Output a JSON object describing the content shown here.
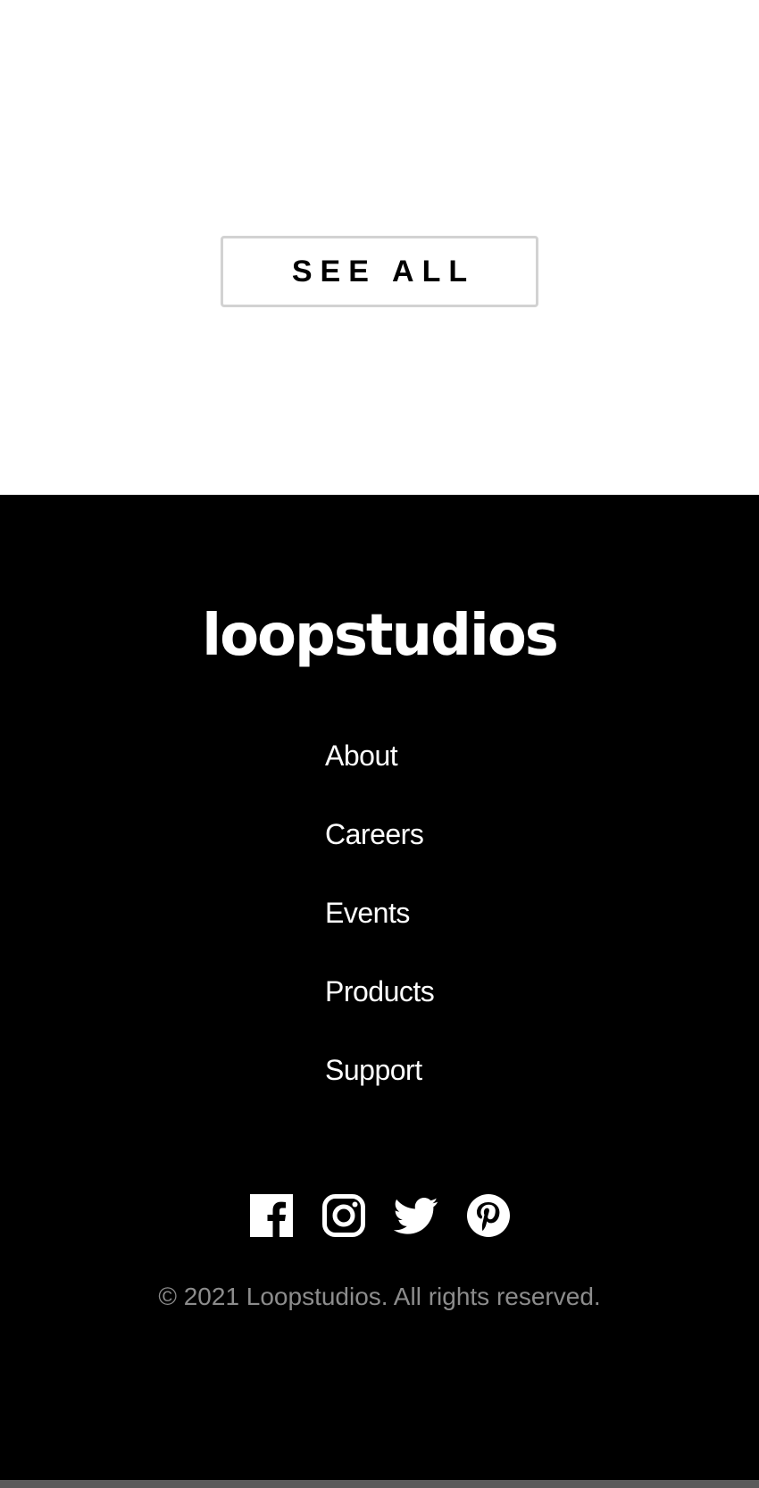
{
  "main": {
    "see_all_label": "SEE ALL"
  },
  "footer": {
    "logo": "loopstudios",
    "nav": [
      {
        "label": "About"
      },
      {
        "label": "Careers"
      },
      {
        "label": "Events"
      },
      {
        "label": "Products"
      },
      {
        "label": "Support"
      }
    ],
    "social_icons": [
      "facebook-icon",
      "instagram-icon",
      "twitter-icon",
      "pinterest-icon"
    ],
    "copyright": "© 2021 Loopstudios. All rights reserved."
  },
  "colors": {
    "footer_background": "#000000",
    "page_background": "#ffffff",
    "button_border": "#d2d2d2",
    "copyright_text": "#8c8c8c"
  }
}
